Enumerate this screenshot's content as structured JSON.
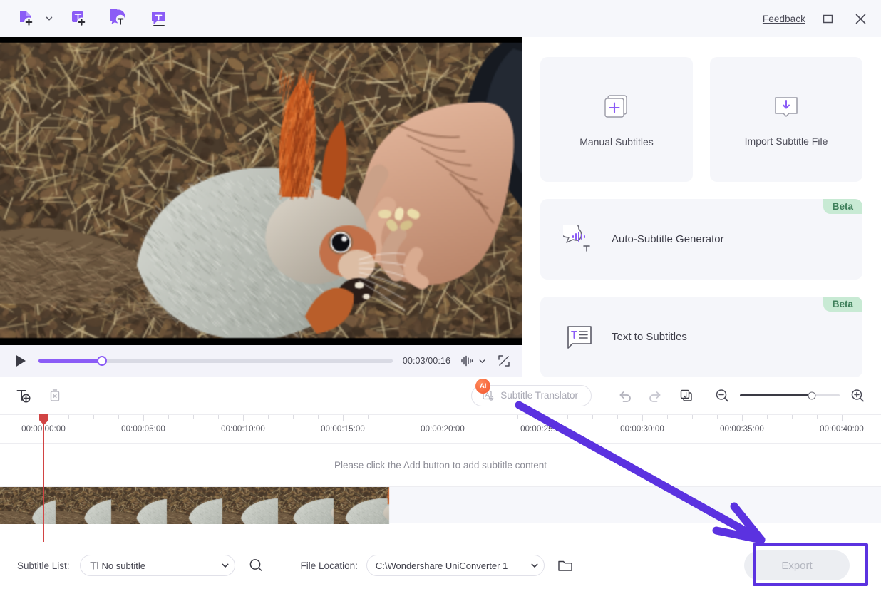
{
  "titlebar": {
    "tools": [
      {
        "name": "add-media-button",
        "icon": "file-plus-icon",
        "label": "Add Files"
      },
      {
        "name": "toolbar-dropdown-caret",
        "icon": "chevron-down-icon",
        "label": ""
      },
      {
        "name": "add-text-button",
        "icon": "text-box-plus-icon",
        "label": "Add Text"
      },
      {
        "name": "auto-subtitle-button",
        "icon": "speech-bubble-t-icon",
        "label": "Auto Subtitle"
      },
      {
        "name": "text-to-subtitle-button",
        "icon": "chat-t-icon",
        "label": "Text to Subtitle"
      }
    ],
    "feedback_label": "Feedback",
    "maximize_label": "Maximize",
    "close_label": "Close"
  },
  "player": {
    "play_label": "Play",
    "timecode": "00:03/00:16",
    "current_time": "00:03",
    "total_time": "00:16",
    "progress_percent": 18,
    "volume_icon": "audio-wave-icon",
    "volume_caret_icon": "chevron-down-icon",
    "fullscreen_icon": "fullscreen-icon"
  },
  "right_panel": {
    "cards": [
      {
        "name": "manual-subtitles-card",
        "label": "Manual Subtitles",
        "icon": "stacked-pages-plus-icon"
      },
      {
        "name": "import-subtitle-file-card",
        "label": "Import Subtitle File",
        "icon": "import-download-icon"
      }
    ],
    "wide_cards": [
      {
        "name": "auto-subtitle-generator-card",
        "label": "Auto-Subtitle Generator",
        "icon": "waveform-bubble-icon",
        "badge": "Beta"
      },
      {
        "name": "text-to-subtitles-card",
        "label": "Text to Subtitles",
        "icon": "text-lines-bubble-icon",
        "badge": "Beta"
      }
    ]
  },
  "subtitle_toolbar": {
    "add_subtitle_label": "Add Subtitle",
    "delete_subtitle_label": "Delete Subtitle",
    "ai_badge": "AI",
    "translator_label": "Subtitle Translator",
    "undo_label": "Undo",
    "redo_label": "Redo",
    "merge_label": "Merge Subtitles",
    "zoom_out_label": "Zoom Out",
    "zoom_in_label": "Zoom In",
    "zoom_percent": 72
  },
  "timeline": {
    "ticks": [
      "00:00:00:00",
      "00:00:05:00",
      "00:00:10:00",
      "00:00:15:00",
      "00:00:20:00",
      "00:00:25:00",
      "00:00:30:00",
      "00:00:35:00",
      "00:00:40:00"
    ],
    "empty_hint": "Please click the Add button to add subtitle content",
    "playhead_time": "00:00:00:00"
  },
  "bottom_bar": {
    "subtitle_list_label": "Subtitle List:",
    "subtitle_list_value": "No subtitle",
    "subtitle_list_icon": "text-cursor-icon",
    "search_label": "Search",
    "file_location_label": "File Location:",
    "file_location_value": "C:\\Wondershare UniConverter 1",
    "folder_label": "Open Folder",
    "export_label": "Export",
    "export_enabled": false
  },
  "annotation": {
    "highlight_color": "#5b32e0",
    "arrow_color": "#5b32e0",
    "target": "export-button"
  },
  "colors": {
    "accent": "#8b5cf6",
    "titlebar_bg": "#f6f7fb",
    "card_bg": "#f5f6fa",
    "beta_bg": "#c8ead4",
    "beta_text": "#3e7f5a",
    "playhead": "#d14343",
    "ai_badge": "#f2542d"
  }
}
